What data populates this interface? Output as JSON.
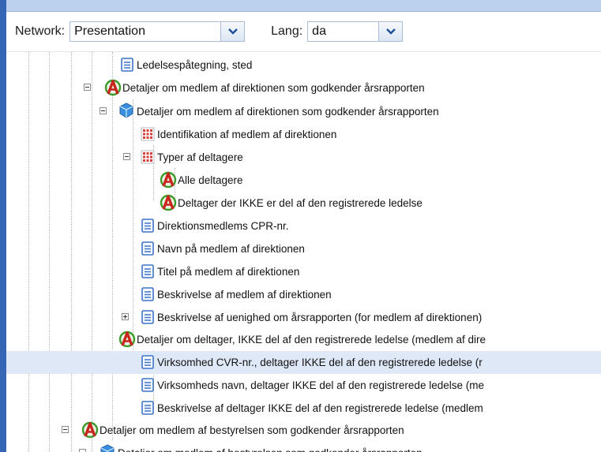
{
  "toolbar": {
    "network_label": "Network:",
    "network_value": "Presentation",
    "lang_label": "Lang:",
    "lang_value": "da"
  },
  "colors": {
    "sidebar": "#3566b5",
    "selection": "#dfe8f6",
    "abstract_icon": "#c8261e",
    "cube_icon": "#3b8fe0",
    "table_icon": "#d9403a",
    "element_icon": "#3f73c8"
  },
  "tree": {
    "items": [
      {
        "label": "Ledelsespåtegning, sted",
        "icon": "element-icon",
        "expander": "none"
      },
      {
        "label": "Detaljer om medlem af direktionen som godkender årsrapporten",
        "icon": "abstract-icon",
        "expander": "minus"
      },
      {
        "label": "Detaljer om medlem af direktionen som godkender årsrapporten",
        "icon": "cube-icon",
        "expander": "minus"
      },
      {
        "label": "Identifikation af medlem af direktionen",
        "icon": "table-icon",
        "expander": "none"
      },
      {
        "label": "Typer af deltagere",
        "icon": "table-icon",
        "expander": "minus"
      },
      {
        "label": "Alle deltagere",
        "icon": "abstract-icon",
        "expander": "none"
      },
      {
        "label": "Deltager der IKKE er del af den registrerede ledelse",
        "icon": "abstract-icon",
        "expander": "none"
      },
      {
        "label": "Direktionsmedlems CPR-nr.",
        "icon": "element-icon",
        "expander": "none"
      },
      {
        "label": "Navn på medlem af direktionen",
        "icon": "element-icon",
        "expander": "none"
      },
      {
        "label": "Titel på medlem af direktionen",
        "icon": "element-icon",
        "expander": "none"
      },
      {
        "label": "Beskrivelse af medlem af direktionen",
        "icon": "element-icon",
        "expander": "none"
      },
      {
        "label": "Beskrivelse af uenighed om årsrapporten (for medlem af direktionen)",
        "icon": "element-icon",
        "expander": "plus"
      },
      {
        "label": "Detaljer om deltager, IKKE del af den registrerede ledelse (medlem af dire",
        "icon": "abstract-icon",
        "expander": "minus"
      },
      {
        "label": "Virksomhed CVR-nr., deltager IKKE del af den registrerede ledelse (r",
        "icon": "element-icon",
        "expander": "none",
        "selected": true
      },
      {
        "label": "Virksomheds navn, deltager IKKE del af den registrerede ledelse (me",
        "icon": "element-icon",
        "expander": "none"
      },
      {
        "label": "Beskrivelse af deltager IKKE del af den registrerede ledelse (medlem",
        "icon": "element-icon",
        "expander": "none"
      },
      {
        "label": "Detaljer om medlem af bestyrelsen som godkender årsrapporten",
        "icon": "abstract-icon",
        "expander": "minus"
      },
      {
        "label": "Detaljer om medlem af bestyrelsen som godkender årsrapporten",
        "icon": "cube-icon",
        "expander": "minus"
      }
    ]
  }
}
